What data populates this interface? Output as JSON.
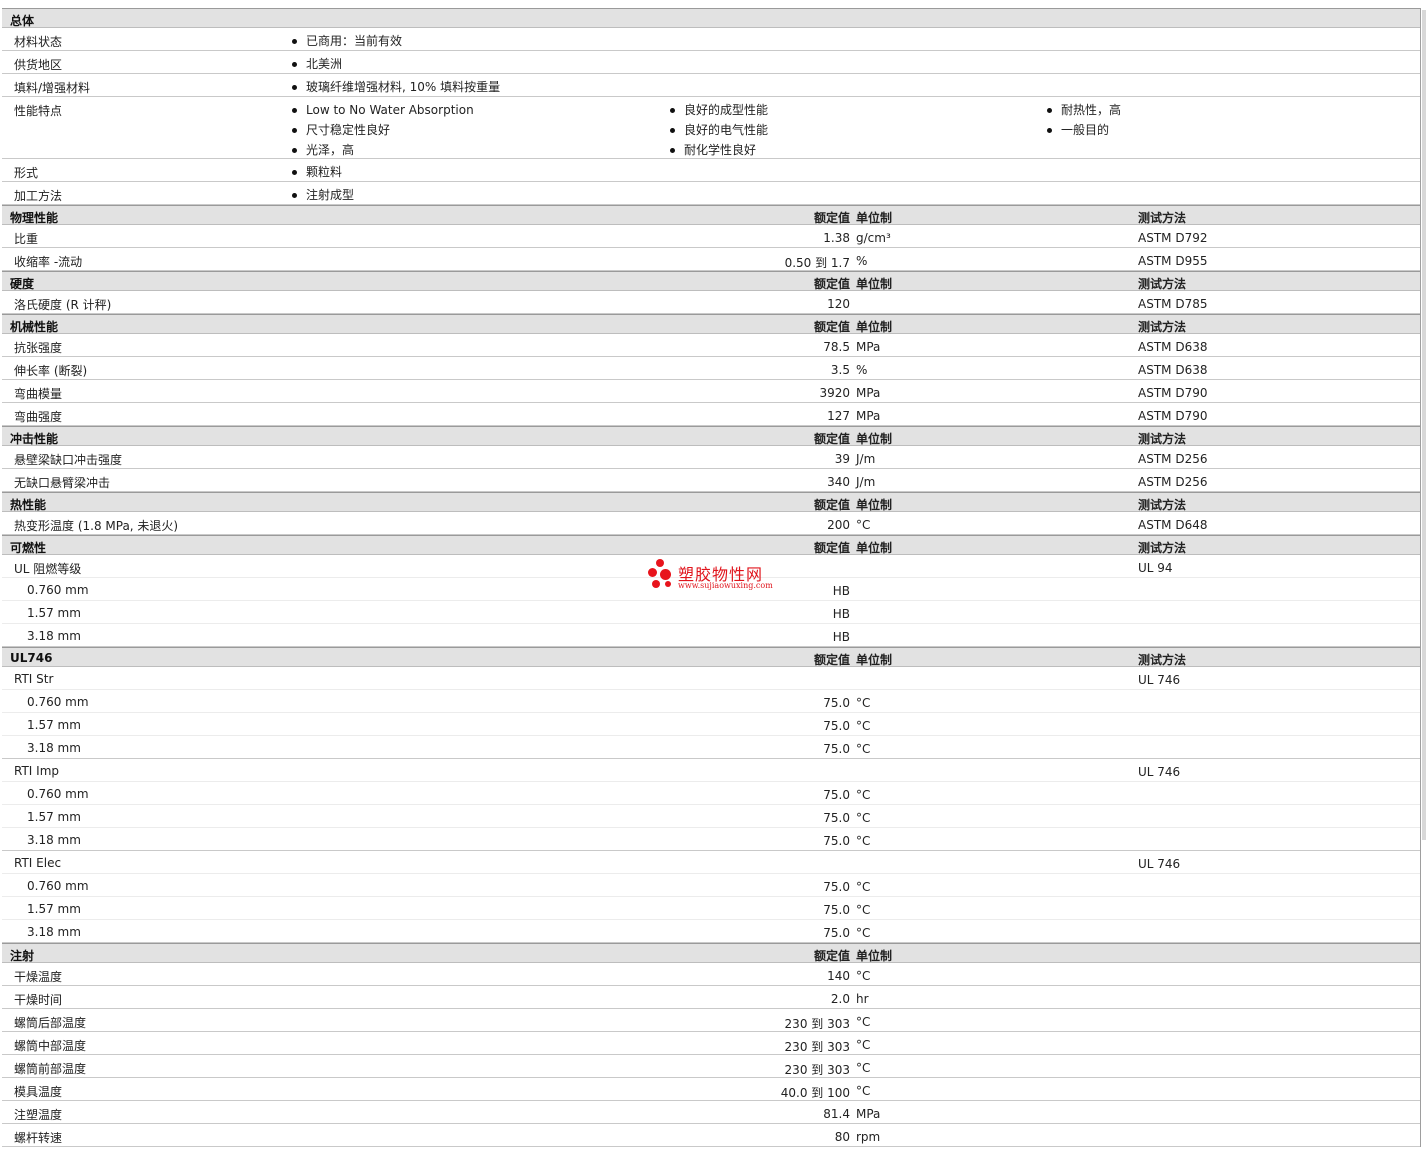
{
  "general": {
    "title": "总体",
    "rows": [
      {
        "label": "材料状态",
        "cols": [
          [
            "已商用：当前有效"
          ]
        ]
      },
      {
        "label": "供货地区",
        "cols": [
          [
            "北美洲"
          ]
        ]
      },
      {
        "label": "填料/增强材料",
        "cols": [
          [
            "玻璃纤维增强材料, 10% 填料按重量"
          ]
        ]
      },
      {
        "label": "性能特点",
        "cols": [
          [
            "Low to No Water Absorption",
            "尺寸稳定性良好",
            "光泽，高"
          ],
          [
            "良好的成型性能",
            "良好的电气性能",
            "耐化学性良好"
          ],
          [
            "耐热性，高",
            "一般目的"
          ]
        ]
      },
      {
        "label": "形式",
        "cols": [
          [
            "颗粒料"
          ]
        ]
      },
      {
        "label": "加工方法",
        "cols": [
          [
            "注射成型"
          ]
        ]
      }
    ]
  },
  "headers": {
    "nominal": "额定值",
    "unit": "单位制",
    "test": "测试方法"
  },
  "sections": [
    {
      "title": "物理性能",
      "show_test": true,
      "rows": [
        {
          "label": "比重",
          "value": "1.38",
          "unit": "g/cm³",
          "test": "ASTM D792"
        },
        {
          "label": "收缩率 -流动",
          "value": "0.50 到  1.7",
          "unit": "%",
          "test": "ASTM D955"
        }
      ]
    },
    {
      "title": "硬度",
      "show_test": true,
      "rows": [
        {
          "label": "洛氏硬度 (R 计秤)",
          "value": "120",
          "unit": "",
          "test": "ASTM D785"
        }
      ]
    },
    {
      "title": "机械性能",
      "show_test": true,
      "rows": [
        {
          "label": "抗张强度",
          "value": "78.5",
          "unit": "MPa",
          "test": "ASTM D638"
        },
        {
          "label": "伸长率 (断裂)",
          "value": "3.5",
          "unit": "%",
          "test": "ASTM D638"
        },
        {
          "label": "弯曲模量",
          "value": "3920",
          "unit": "MPa",
          "test": "ASTM D790"
        },
        {
          "label": "弯曲强度",
          "value": "127",
          "unit": "MPa",
          "test": "ASTM D790"
        }
      ]
    },
    {
      "title": "冲击性能",
      "show_test": true,
      "rows": [
        {
          "label": "悬壁梁缺口冲击强度",
          "value": "39",
          "unit": "J/m",
          "test": "ASTM D256"
        },
        {
          "label": "无缺口悬臂梁冲击",
          "value": "340",
          "unit": "J/m",
          "test": "ASTM D256"
        }
      ]
    },
    {
      "title": "热性能",
      "show_test": true,
      "rows": [
        {
          "label": "热变形温度 (1.8 MPa, 未退火)",
          "value": "200",
          "unit": "°C",
          "test": "ASTM D648"
        }
      ]
    },
    {
      "title": "可燃性",
      "show_test": true,
      "rows": [
        {
          "label": "UL 阻燃等级",
          "value": "",
          "unit": "",
          "test": "UL 94"
        },
        {
          "label": "0.760 mm",
          "value": "HB",
          "unit": "",
          "test": "",
          "indent": true
        },
        {
          "label": "1.57 mm",
          "value": "HB",
          "unit": "",
          "test": "",
          "indent": true
        },
        {
          "label": "3.18 mm",
          "value": "HB",
          "unit": "",
          "test": "",
          "indent": true
        }
      ]
    },
    {
      "title": "UL746",
      "show_test": true,
      "rows": [
        {
          "label": "RTI Str",
          "value": "",
          "unit": "",
          "test": "UL 746"
        },
        {
          "label": "0.760 mm",
          "value": "75.0",
          "unit": "°C",
          "test": "",
          "indent": true
        },
        {
          "label": "1.57 mm",
          "value": "75.0",
          "unit": "°C",
          "test": "",
          "indent": true
        },
        {
          "label": "3.18 mm",
          "value": "75.0",
          "unit": "°C",
          "test": "",
          "indent": true
        },
        {
          "label": "RTI Imp",
          "value": "",
          "unit": "",
          "test": "UL 746"
        },
        {
          "label": "0.760 mm",
          "value": "75.0",
          "unit": "°C",
          "test": "",
          "indent": true
        },
        {
          "label": "1.57 mm",
          "value": "75.0",
          "unit": "°C",
          "test": "",
          "indent": true
        },
        {
          "label": "3.18 mm",
          "value": "75.0",
          "unit": "°C",
          "test": "",
          "indent": true
        },
        {
          "label": "RTI Elec",
          "value": "",
          "unit": "",
          "test": "UL 746"
        },
        {
          "label": "0.760 mm",
          "value": "75.0",
          "unit": "°C",
          "test": "",
          "indent": true
        },
        {
          "label": "1.57 mm",
          "value": "75.0",
          "unit": "°C",
          "test": "",
          "indent": true
        },
        {
          "label": "3.18 mm",
          "value": "75.0",
          "unit": "°C",
          "test": "",
          "indent": true
        }
      ]
    },
    {
      "title": "注射",
      "show_test": false,
      "rows": [
        {
          "label": "干燥温度",
          "value": "140",
          "unit": "°C",
          "test": ""
        },
        {
          "label": "干燥时间",
          "value": "2.0",
          "unit": "hr",
          "test": ""
        },
        {
          "label": "螺筒后部温度",
          "value": "230 到  303",
          "unit": "°C",
          "test": ""
        },
        {
          "label": "螺筒中部温度",
          "value": "230 到  303",
          "unit": "°C",
          "test": ""
        },
        {
          "label": "螺筒前部温度",
          "value": "230 到  303",
          "unit": "°C",
          "test": ""
        },
        {
          "label": "模具温度",
          "value": "40.0 到  100",
          "unit": "°C",
          "test": ""
        },
        {
          "label": "注塑温度",
          "value": "81.4",
          "unit": "MPa",
          "test": ""
        },
        {
          "label": "螺杆转速",
          "value": "80",
          "unit": "rpm",
          "test": ""
        }
      ]
    }
  ],
  "watermark": {
    "name": "塑胶物性网",
    "url": "www.sujiaowuxing.com",
    "color": "#e0141c"
  }
}
